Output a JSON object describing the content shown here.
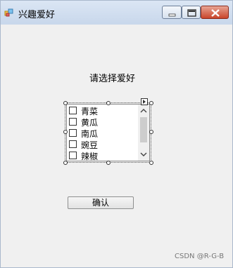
{
  "window": {
    "title": "兴趣爱好"
  },
  "form": {
    "prompt": "请选择爱好",
    "items": [
      {
        "label": "青菜",
        "checked": false
      },
      {
        "label": "黄瓜",
        "checked": false
      },
      {
        "label": "南瓜",
        "checked": false
      },
      {
        "label": "豌豆",
        "checked": false
      },
      {
        "label": "辣椒",
        "checked": false
      }
    ],
    "confirm_label": "确认"
  },
  "watermark": "CSDN @R-G-B"
}
